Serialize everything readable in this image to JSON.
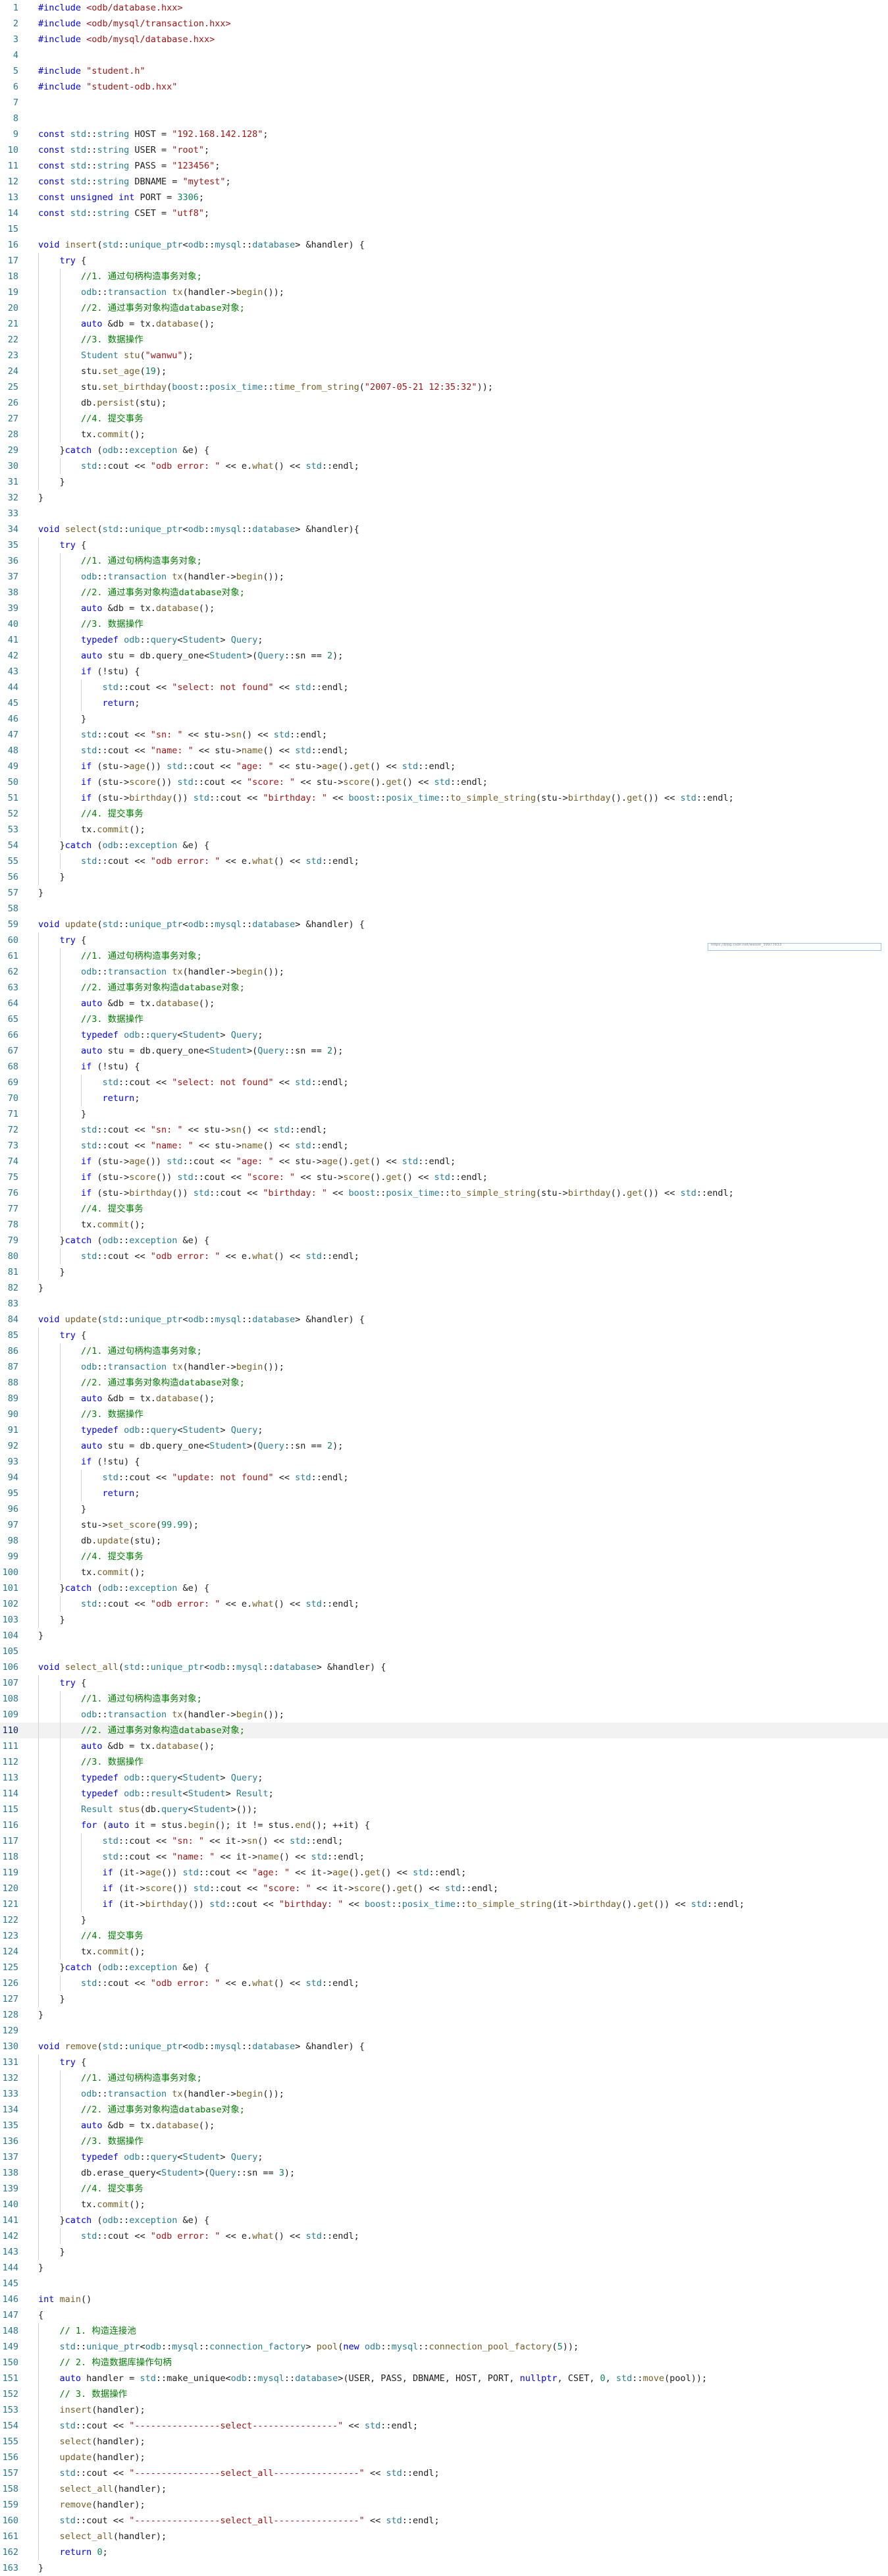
{
  "editor": {
    "current_line": 110,
    "hover_hint": "https://blog.csdn.net/weixin_39977633",
    "lines": [
      {
        "n": 1,
        "t": "#include <odb/database.hxx>"
      },
      {
        "n": 2,
        "t": "#include <odb/mysql/transaction.hxx>"
      },
      {
        "n": 3,
        "t": "#include <odb/mysql/database.hxx>"
      },
      {
        "n": 4,
        "t": ""
      },
      {
        "n": 5,
        "t": "#include \"student.h\""
      },
      {
        "n": 6,
        "t": "#include \"student-odb.hxx\""
      },
      {
        "n": 7,
        "t": ""
      },
      {
        "n": 8,
        "t": ""
      },
      {
        "n": 9,
        "t": "const std::string HOST = \"192.168.142.128\";"
      },
      {
        "n": 10,
        "t": "const std::string USER = \"root\";"
      },
      {
        "n": 11,
        "t": "const std::string PASS = \"123456\";"
      },
      {
        "n": 12,
        "t": "const std::string DBNAME = \"mytest\";"
      },
      {
        "n": 13,
        "t": "const unsigned int PORT = 3306;"
      },
      {
        "n": 14,
        "t": "const std::string CSET = \"utf8\";"
      },
      {
        "n": 15,
        "t": ""
      },
      {
        "n": 16,
        "t": "void insert(std::unique_ptr<odb::mysql::database> &handler) {"
      },
      {
        "n": 17,
        "t": "    try {"
      },
      {
        "n": 18,
        "t": "        //1. 通过句柄构造事务对象;"
      },
      {
        "n": 19,
        "t": "        odb::transaction tx(handler->begin());"
      },
      {
        "n": 20,
        "t": "        //2. 通过事务对象构造database对象;"
      },
      {
        "n": 21,
        "t": "        auto &db = tx.database();"
      },
      {
        "n": 22,
        "t": "        //3. 数据操作"
      },
      {
        "n": 23,
        "t": "        Student stu(\"wanwu\");"
      },
      {
        "n": 24,
        "t": "        stu.set_age(19);"
      },
      {
        "n": 25,
        "t": "        stu.set_birthday(boost::posix_time::time_from_string(\"2007-05-21 12:35:32\"));"
      },
      {
        "n": 26,
        "t": "        db.persist(stu);"
      },
      {
        "n": 27,
        "t": "        //4. 提交事务"
      },
      {
        "n": 28,
        "t": "        tx.commit();"
      },
      {
        "n": 29,
        "t": "    }catch (odb::exception &e) {"
      },
      {
        "n": 30,
        "t": "        std::cout << \"odb error: \" << e.what() << std::endl;"
      },
      {
        "n": 31,
        "t": "    }"
      },
      {
        "n": 32,
        "t": "}"
      },
      {
        "n": 33,
        "t": ""
      },
      {
        "n": 34,
        "t": "void select(std::unique_ptr<odb::mysql::database> &handler){"
      },
      {
        "n": 35,
        "t": "    try {"
      },
      {
        "n": 36,
        "t": "        //1. 通过句柄构造事务对象;"
      },
      {
        "n": 37,
        "t": "        odb::transaction tx(handler->begin());"
      },
      {
        "n": 38,
        "t": "        //2. 通过事务对象构造database对象;"
      },
      {
        "n": 39,
        "t": "        auto &db = tx.database();"
      },
      {
        "n": 40,
        "t": "        //3. 数据操作"
      },
      {
        "n": 41,
        "t": "        typedef odb::query<Student> Query;"
      },
      {
        "n": 42,
        "t": "        auto stu = db.query_one<Student>(Query::sn == 2);"
      },
      {
        "n": 43,
        "t": "        if (!stu) {"
      },
      {
        "n": 44,
        "t": "            std::cout << \"select: not found\" << std::endl;"
      },
      {
        "n": 45,
        "t": "            return;"
      },
      {
        "n": 46,
        "t": "        }"
      },
      {
        "n": 47,
        "t": "        std::cout << \"sn: \" << stu->sn() << std::endl;"
      },
      {
        "n": 48,
        "t": "        std::cout << \"name: \" << stu->name() << std::endl;"
      },
      {
        "n": 49,
        "t": "        if (stu->age()) std::cout << \"age: \" << stu->age().get() << std::endl;"
      },
      {
        "n": 50,
        "t": "        if (stu->score()) std::cout << \"score: \" << stu->score().get() << std::endl;"
      },
      {
        "n": 51,
        "t": "        if (stu->birthday()) std::cout << \"birthday: \" << boost::posix_time::to_simple_string(stu->birthday().get()) << std::endl;"
      },
      {
        "n": 52,
        "t": "        //4. 提交事务"
      },
      {
        "n": 53,
        "t": "        tx.commit();"
      },
      {
        "n": 54,
        "t": "    }catch (odb::exception &e) {"
      },
      {
        "n": 55,
        "t": "        std::cout << \"odb error: \" << e.what() << std::endl;"
      },
      {
        "n": 56,
        "t": "    }"
      },
      {
        "n": 57,
        "t": "}"
      },
      {
        "n": 58,
        "t": ""
      },
      {
        "n": 59,
        "t": "void update(std::unique_ptr<odb::mysql::database> &handler) {"
      },
      {
        "n": 60,
        "t": "    try {"
      },
      {
        "n": 61,
        "t": "        //1. 通过句柄构造事务对象;"
      },
      {
        "n": 62,
        "t": "        odb::transaction tx(handler->begin());"
      },
      {
        "n": 63,
        "t": "        //2. 通过事务对象构造database对象;"
      },
      {
        "n": 64,
        "t": "        auto &db = tx.database();"
      },
      {
        "n": 65,
        "t": "        //3. 数据操作"
      },
      {
        "n": 66,
        "t": "        typedef odb::query<Student> Query;"
      },
      {
        "n": 67,
        "t": "        auto stu = db.query_one<Student>(Query::sn == 2);"
      },
      {
        "n": 68,
        "t": "        if (!stu) {"
      },
      {
        "n": 69,
        "t": "            std::cout << \"select: not found\" << std::endl;"
      },
      {
        "n": 70,
        "t": "            return;"
      },
      {
        "n": 71,
        "t": "        }"
      },
      {
        "n": 72,
        "t": "        std::cout << \"sn: \" << stu->sn() << std::endl;"
      },
      {
        "n": 73,
        "t": "        std::cout << \"name: \" << stu->name() << std::endl;"
      },
      {
        "n": 74,
        "t": "        if (stu->age()) std::cout << \"age: \" << stu->age().get() << std::endl;"
      },
      {
        "n": 75,
        "t": "        if (stu->score()) std::cout << \"score: \" << stu->score().get() << std::endl;"
      },
      {
        "n": 76,
        "t": "        if (stu->birthday()) std::cout << \"birthday: \" << boost::posix_time::to_simple_string(stu->birthday().get()) << std::endl;"
      },
      {
        "n": 77,
        "t": "        //4. 提交事务"
      },
      {
        "n": 78,
        "t": "        tx.commit();"
      },
      {
        "n": 79,
        "t": "    }catch (odb::exception &e) {"
      },
      {
        "n": 80,
        "t": "        std::cout << \"odb error: \" << e.what() << std::endl;"
      },
      {
        "n": 81,
        "t": "    }"
      },
      {
        "n": 82,
        "t": "}"
      },
      {
        "n": 83,
        "t": ""
      },
      {
        "n": 84,
        "t": "void update(std::unique_ptr<odb::mysql::database> &handler) {"
      },
      {
        "n": 85,
        "t": "    try {"
      },
      {
        "n": 86,
        "t": "        //1. 通过句柄构造事务对象;"
      },
      {
        "n": 87,
        "t": "        odb::transaction tx(handler->begin());"
      },
      {
        "n": 88,
        "t": "        //2. 通过事务对象构造database对象;"
      },
      {
        "n": 89,
        "t": "        auto &db = tx.database();"
      },
      {
        "n": 90,
        "t": "        //3. 数据操作"
      },
      {
        "n": 91,
        "t": "        typedef odb::query<Student> Query;"
      },
      {
        "n": 92,
        "t": "        auto stu = db.query_one<Student>(Query::sn == 2);"
      },
      {
        "n": 93,
        "t": "        if (!stu) {"
      },
      {
        "n": 94,
        "t": "            std::cout << \"update: not found\" << std::endl;"
      },
      {
        "n": 95,
        "t": "            return;"
      },
      {
        "n": 96,
        "t": "        }"
      },
      {
        "n": 97,
        "t": "        stu->set_score(99.99);"
      },
      {
        "n": 98,
        "t": "        db.update(stu);"
      },
      {
        "n": 99,
        "t": "        //4. 提交事务"
      },
      {
        "n": 100,
        "t": "        tx.commit();"
      },
      {
        "n": 101,
        "t": "    }catch (odb::exception &e) {"
      },
      {
        "n": 102,
        "t": "        std::cout << \"odb error: \" << e.what() << std::endl;"
      },
      {
        "n": 103,
        "t": "    }"
      },
      {
        "n": 104,
        "t": "}"
      },
      {
        "n": 105,
        "t": ""
      },
      {
        "n": 106,
        "t": "void select_all(std::unique_ptr<odb::mysql::database> &handler) {"
      },
      {
        "n": 107,
        "t": "    try {"
      },
      {
        "n": 108,
        "t": "        //1. 通过句柄构造事务对象;"
      },
      {
        "n": 109,
        "t": "        odb::transaction tx(handler->begin());"
      },
      {
        "n": 110,
        "t": "        //2. 通过事务对象构造database对象;"
      },
      {
        "n": 111,
        "t": "        auto &db = tx.database();"
      },
      {
        "n": 112,
        "t": "        //3. 数据操作"
      },
      {
        "n": 113,
        "t": "        typedef odb::query<Student> Query;"
      },
      {
        "n": 114,
        "t": "        typedef odb::result<Student> Result;"
      },
      {
        "n": 115,
        "t": "        Result stus(db.query<Student>());"
      },
      {
        "n": 116,
        "t": "        for (auto it = stus.begin(); it != stus.end(); ++it) {"
      },
      {
        "n": 117,
        "t": "            std::cout << \"sn: \" << it->sn() << std::endl;"
      },
      {
        "n": 118,
        "t": "            std::cout << \"name: \" << it->name() << std::endl;"
      },
      {
        "n": 119,
        "t": "            if (it->age()) std::cout << \"age: \" << it->age().get() << std::endl;"
      },
      {
        "n": 120,
        "t": "            if (it->score()) std::cout << \"score: \" << it->score().get() << std::endl;"
      },
      {
        "n": 121,
        "t": "            if (it->birthday()) std::cout << \"birthday: \" << boost::posix_time::to_simple_string(it->birthday().get()) << std::endl;"
      },
      {
        "n": 122,
        "t": "        }"
      },
      {
        "n": 123,
        "t": "        //4. 提交事务"
      },
      {
        "n": 124,
        "t": "        tx.commit();"
      },
      {
        "n": 125,
        "t": "    }catch (odb::exception &e) {"
      },
      {
        "n": 126,
        "t": "        std::cout << \"odb error: \" << e.what() << std::endl;"
      },
      {
        "n": 127,
        "t": "    }"
      },
      {
        "n": 128,
        "t": "}"
      },
      {
        "n": 129,
        "t": ""
      },
      {
        "n": 130,
        "t": "void remove(std::unique_ptr<odb::mysql::database> &handler) {"
      },
      {
        "n": 131,
        "t": "    try {"
      },
      {
        "n": 132,
        "t": "        //1. 通过句柄构造事务对象;"
      },
      {
        "n": 133,
        "t": "        odb::transaction tx(handler->begin());"
      },
      {
        "n": 134,
        "t": "        //2. 通过事务对象构造database对象;"
      },
      {
        "n": 135,
        "t": "        auto &db = tx.database();"
      },
      {
        "n": 136,
        "t": "        //3. 数据操作"
      },
      {
        "n": 137,
        "t": "        typedef odb::query<Student> Query;"
      },
      {
        "n": 138,
        "t": "        db.erase_query<Student>(Query::sn == 3);"
      },
      {
        "n": 139,
        "t": "        //4. 提交事务"
      },
      {
        "n": 140,
        "t": "        tx.commit();"
      },
      {
        "n": 141,
        "t": "    }catch (odb::exception &e) {"
      },
      {
        "n": 142,
        "t": "        std::cout << \"odb error: \" << e.what() << std::endl;"
      },
      {
        "n": 143,
        "t": "    }"
      },
      {
        "n": 144,
        "t": "}"
      },
      {
        "n": 145,
        "t": ""
      },
      {
        "n": 146,
        "t": "int main()"
      },
      {
        "n": 147,
        "t": "{"
      },
      {
        "n": 148,
        "t": "    // 1. 构造连接池"
      },
      {
        "n": 149,
        "t": "    std::unique_ptr<odb::mysql::connection_factory> pool(new odb::mysql::connection_pool_factory(5));"
      },
      {
        "n": 150,
        "t": "    // 2. 构造数据库操作句柄"
      },
      {
        "n": 151,
        "t": "    auto handler = std::make_unique<odb::mysql::database>(USER, PASS, DBNAME, HOST, PORT, nullptr, CSET, 0, std::move(pool));"
      },
      {
        "n": 152,
        "t": "    // 3. 数据操作"
      },
      {
        "n": 153,
        "t": "    insert(handler);"
      },
      {
        "n": 154,
        "t": "    std::cout << \"----------------select----------------\" << std::endl;"
      },
      {
        "n": 155,
        "t": "    select(handler);"
      },
      {
        "n": 156,
        "t": "    update(handler);"
      },
      {
        "n": 157,
        "t": "    std::cout << \"----------------select_all----------------\" << std::endl;"
      },
      {
        "n": 158,
        "t": "    select_all(handler);"
      },
      {
        "n": 159,
        "t": "    remove(handler);"
      },
      {
        "n": 160,
        "t": "    std::cout << \"----------------select_all----------------\" << std::endl;"
      },
      {
        "n": 161,
        "t": "    select_all(handler);"
      },
      {
        "n": 162,
        "t": "    return 0;"
      },
      {
        "n": 163,
        "t": "}"
      }
    ]
  }
}
